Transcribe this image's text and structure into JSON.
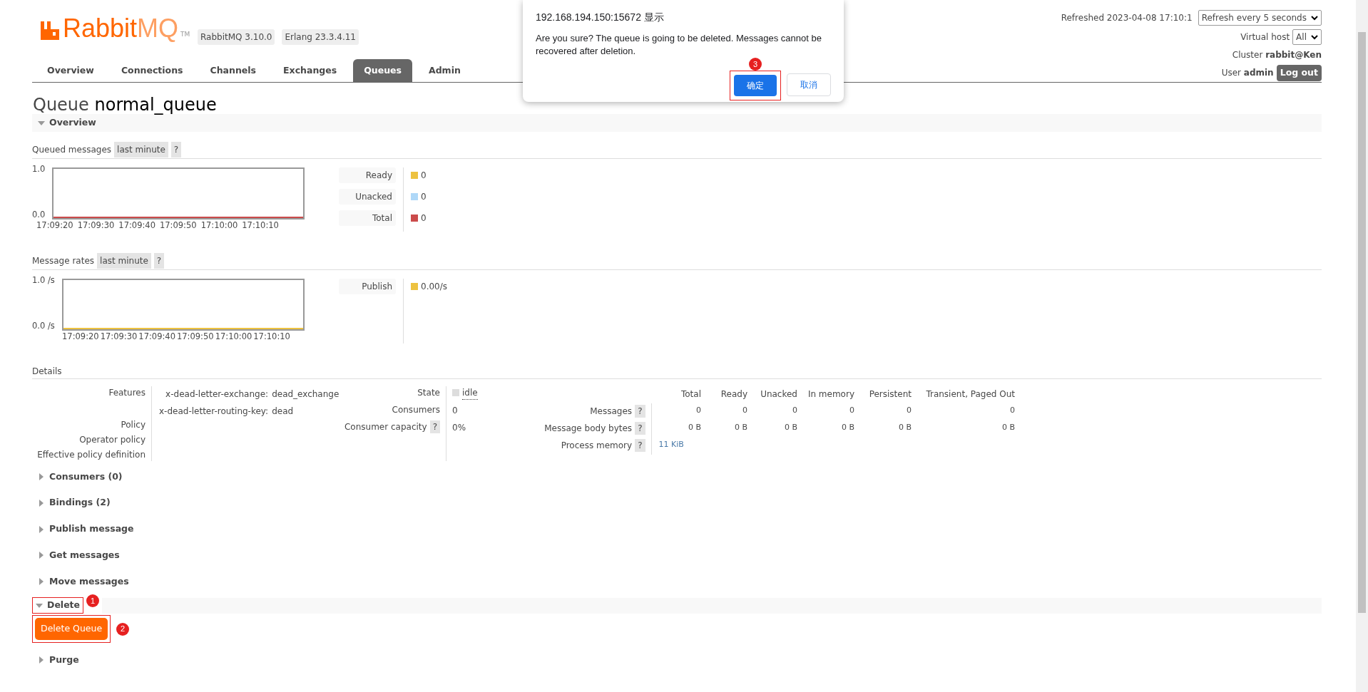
{
  "header": {
    "logo": "Rabbit",
    "logo_suffix": "MQ",
    "logo_tm": "TM",
    "versions": [
      "RabbitMQ 3.10.0",
      "Erlang 23.3.4.11"
    ],
    "refreshed": "Refreshed 2023-04-08 17:10:1",
    "refresh_select": "Refresh every 5 seconds",
    "virtual_host": {
      "label": "Virtual host",
      "value": "All"
    },
    "cluster": {
      "label": "Cluster",
      "value": "rabbit@Ken"
    },
    "user": {
      "label": "User",
      "value": "admin"
    },
    "logout": "Log out"
  },
  "tabs": [
    {
      "label": "Overview",
      "selected": false
    },
    {
      "label": "Connections",
      "selected": false
    },
    {
      "label": "Channels",
      "selected": false
    },
    {
      "label": "Exchanges",
      "selected": false
    },
    {
      "label": "Queues",
      "selected": true
    },
    {
      "label": "Admin",
      "selected": false
    }
  ],
  "page_title": {
    "prefix": "Queue",
    "name": "normal_queue"
  },
  "overview": {
    "title": "Overview",
    "expanded": true
  },
  "charts": [
    {
      "label": "Queued messages",
      "range": "last minute",
      "help": "?",
      "y_ticks": [
        "1.0",
        "0.0"
      ],
      "x_ticks": [
        "17:09:20",
        "17:09:30",
        "17:09:40",
        "17:09:50",
        "17:10:00",
        "17:10:10"
      ],
      "legend": [
        {
          "label": "Ready",
          "color": "#edc240",
          "value": "0"
        },
        {
          "label": "Unacked",
          "color": "#afd8f8",
          "value": "0"
        },
        {
          "label": "Total",
          "color": "#cb4b4b",
          "value": "0"
        }
      ]
    },
    {
      "label": "Message rates",
      "range": "last minute",
      "help": "?",
      "y_ticks": [
        "1.0 /s",
        "0.0 /s"
      ],
      "x_ticks": [
        "17:09:20",
        "17:09:30",
        "17:09:40",
        "17:09:50",
        "17:10:00",
        "17:10:10"
      ],
      "legend": [
        {
          "label": "Publish",
          "color": "#edc240",
          "value": "0.00/s"
        }
      ]
    }
  ],
  "details": {
    "title": "Details",
    "labels": [
      "Features",
      "Policy",
      "Operator policy",
      "Effective policy definition"
    ],
    "features": [
      {
        "key": "x-dead-letter-exchange:",
        "value": "dead_exchange"
      },
      {
        "key": "x-dead-letter-routing-key:",
        "value": "dead"
      }
    ],
    "state": {
      "label": "State",
      "value": "idle"
    },
    "consumers": {
      "label": "Consumers",
      "value": "0"
    },
    "capacity": {
      "label": "Consumer capacity",
      "help": "?",
      "value": "0%"
    },
    "columns": [
      "Total",
      "Ready",
      "Unacked",
      "In memory",
      "Persistent",
      "Transient, Paged Out"
    ],
    "rows": [
      {
        "label": "Messages",
        "help": "?",
        "cells": [
          "0",
          "0",
          "0",
          "0",
          "0",
          "0"
        ]
      },
      {
        "label": "Message body bytes",
        "help": "?",
        "cells": [
          "0 B",
          "0 B",
          "0 B",
          "0 B",
          "0 B",
          "0 B"
        ]
      },
      {
        "label": "Process memory",
        "help": "?",
        "cells": [
          "11 KiB"
        ]
      }
    ]
  },
  "sections": [
    {
      "title": "Consumers (0)",
      "expanded": false
    },
    {
      "title": "Bindings (2)",
      "expanded": false
    },
    {
      "title": "Publish message",
      "expanded": false
    },
    {
      "title": "Get messages",
      "expanded": false
    },
    {
      "title": "Move messages",
      "expanded": false
    },
    {
      "title": "Delete",
      "expanded": true,
      "marker": "1",
      "button": "Delete Queue",
      "button_marker": "2"
    },
    {
      "title": "Purge",
      "expanded": false
    }
  ],
  "dialog": {
    "title": "192.168.194.150:15672 显示",
    "message": "Are you sure? The queue is going to be deleted. Messages cannot be recovered after deletion.",
    "ok": "确定",
    "ok_marker": "3",
    "cancel": "取消"
  }
}
